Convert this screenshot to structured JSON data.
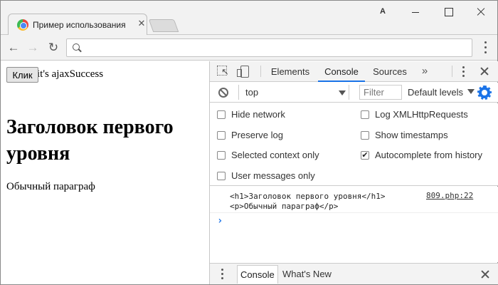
{
  "browser": {
    "tab_title": "Пример использования",
    "tab_close_glyph": "✕",
    "profile_glyph": "A",
    "nav": {
      "back": "←",
      "forward": "→",
      "reload": "↻"
    },
    "address": ""
  },
  "page": {
    "button_label": "Клик",
    "status_text": "it's ajaxSuccess",
    "heading": "Заголовок первого уровня",
    "paragraph": "Обычный параграф"
  },
  "devtools": {
    "tabs": [
      "Elements",
      "Console",
      "Sources"
    ],
    "active_tab": "Console",
    "more_glyph": "»",
    "context": "top",
    "filter_placeholder": "Filter",
    "levels": "Default levels",
    "settings": {
      "hide_network": {
        "label": "Hide network",
        "checked": false
      },
      "log_xhr": {
        "label": "Log XMLHttpRequests",
        "checked": false
      },
      "preserve_log": {
        "label": "Preserve log",
        "checked": false
      },
      "show_timestamps": {
        "label": "Show timestamps",
        "checked": false
      },
      "selected_context": {
        "label": "Selected context only",
        "checked": false
      },
      "autocomplete": {
        "label": "Autocomplete from history",
        "checked": true
      },
      "user_messages": {
        "label": "User messages only",
        "checked": false
      }
    },
    "console_message": {
      "line1": "<h1>Заголовок первого уровня</h1>",
      "line2": "<p>Обычный параграф</p>",
      "source": "809.php:22"
    },
    "prompt_glyph": "›",
    "drawer": {
      "tabs": [
        "Console",
        "What's New"
      ],
      "active": "Console"
    }
  },
  "colors": {
    "accent": "#1a73e8"
  }
}
